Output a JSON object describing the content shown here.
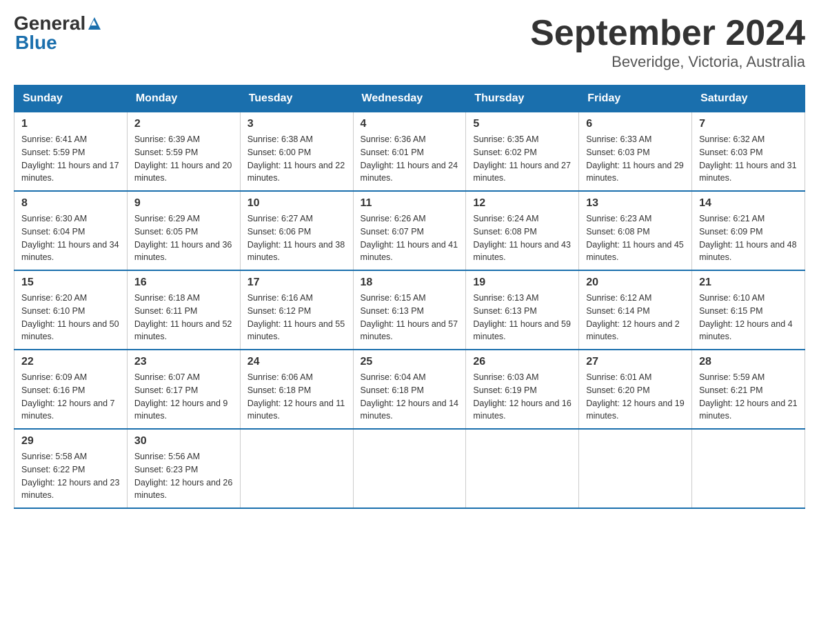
{
  "logo": {
    "text_general": "General",
    "text_blue": "Blue"
  },
  "title": "September 2024",
  "subtitle": "Beveridge, Victoria, Australia",
  "days_of_week": [
    "Sunday",
    "Monday",
    "Tuesday",
    "Wednesday",
    "Thursday",
    "Friday",
    "Saturday"
  ],
  "weeks": [
    [
      {
        "day": "1",
        "sunrise": "6:41 AM",
        "sunset": "5:59 PM",
        "daylight": "11 hours and 17 minutes."
      },
      {
        "day": "2",
        "sunrise": "6:39 AM",
        "sunset": "5:59 PM",
        "daylight": "11 hours and 20 minutes."
      },
      {
        "day": "3",
        "sunrise": "6:38 AM",
        "sunset": "6:00 PM",
        "daylight": "11 hours and 22 minutes."
      },
      {
        "day": "4",
        "sunrise": "6:36 AM",
        "sunset": "6:01 PM",
        "daylight": "11 hours and 24 minutes."
      },
      {
        "day": "5",
        "sunrise": "6:35 AM",
        "sunset": "6:02 PM",
        "daylight": "11 hours and 27 minutes."
      },
      {
        "day": "6",
        "sunrise": "6:33 AM",
        "sunset": "6:03 PM",
        "daylight": "11 hours and 29 minutes."
      },
      {
        "day": "7",
        "sunrise": "6:32 AM",
        "sunset": "6:03 PM",
        "daylight": "11 hours and 31 minutes."
      }
    ],
    [
      {
        "day": "8",
        "sunrise": "6:30 AM",
        "sunset": "6:04 PM",
        "daylight": "11 hours and 34 minutes."
      },
      {
        "day": "9",
        "sunrise": "6:29 AM",
        "sunset": "6:05 PM",
        "daylight": "11 hours and 36 minutes."
      },
      {
        "day": "10",
        "sunrise": "6:27 AM",
        "sunset": "6:06 PM",
        "daylight": "11 hours and 38 minutes."
      },
      {
        "day": "11",
        "sunrise": "6:26 AM",
        "sunset": "6:07 PM",
        "daylight": "11 hours and 41 minutes."
      },
      {
        "day": "12",
        "sunrise": "6:24 AM",
        "sunset": "6:08 PM",
        "daylight": "11 hours and 43 minutes."
      },
      {
        "day": "13",
        "sunrise": "6:23 AM",
        "sunset": "6:08 PM",
        "daylight": "11 hours and 45 minutes."
      },
      {
        "day": "14",
        "sunrise": "6:21 AM",
        "sunset": "6:09 PM",
        "daylight": "11 hours and 48 minutes."
      }
    ],
    [
      {
        "day": "15",
        "sunrise": "6:20 AM",
        "sunset": "6:10 PM",
        "daylight": "11 hours and 50 minutes."
      },
      {
        "day": "16",
        "sunrise": "6:18 AM",
        "sunset": "6:11 PM",
        "daylight": "11 hours and 52 minutes."
      },
      {
        "day": "17",
        "sunrise": "6:16 AM",
        "sunset": "6:12 PM",
        "daylight": "11 hours and 55 minutes."
      },
      {
        "day": "18",
        "sunrise": "6:15 AM",
        "sunset": "6:13 PM",
        "daylight": "11 hours and 57 minutes."
      },
      {
        "day": "19",
        "sunrise": "6:13 AM",
        "sunset": "6:13 PM",
        "daylight": "11 hours and 59 minutes."
      },
      {
        "day": "20",
        "sunrise": "6:12 AM",
        "sunset": "6:14 PM",
        "daylight": "12 hours and 2 minutes."
      },
      {
        "day": "21",
        "sunrise": "6:10 AM",
        "sunset": "6:15 PM",
        "daylight": "12 hours and 4 minutes."
      }
    ],
    [
      {
        "day": "22",
        "sunrise": "6:09 AM",
        "sunset": "6:16 PM",
        "daylight": "12 hours and 7 minutes."
      },
      {
        "day": "23",
        "sunrise": "6:07 AM",
        "sunset": "6:17 PM",
        "daylight": "12 hours and 9 minutes."
      },
      {
        "day": "24",
        "sunrise": "6:06 AM",
        "sunset": "6:18 PM",
        "daylight": "12 hours and 11 minutes."
      },
      {
        "day": "25",
        "sunrise": "6:04 AM",
        "sunset": "6:18 PM",
        "daylight": "12 hours and 14 minutes."
      },
      {
        "day": "26",
        "sunrise": "6:03 AM",
        "sunset": "6:19 PM",
        "daylight": "12 hours and 16 minutes."
      },
      {
        "day": "27",
        "sunrise": "6:01 AM",
        "sunset": "6:20 PM",
        "daylight": "12 hours and 19 minutes."
      },
      {
        "day": "28",
        "sunrise": "5:59 AM",
        "sunset": "6:21 PM",
        "daylight": "12 hours and 21 minutes."
      }
    ],
    [
      {
        "day": "29",
        "sunrise": "5:58 AM",
        "sunset": "6:22 PM",
        "daylight": "12 hours and 23 minutes."
      },
      {
        "day": "30",
        "sunrise": "5:56 AM",
        "sunset": "6:23 PM",
        "daylight": "12 hours and 26 minutes."
      },
      null,
      null,
      null,
      null,
      null
    ]
  ],
  "labels": {
    "sunrise": "Sunrise: ",
    "sunset": "Sunset: ",
    "daylight": "Daylight: "
  }
}
